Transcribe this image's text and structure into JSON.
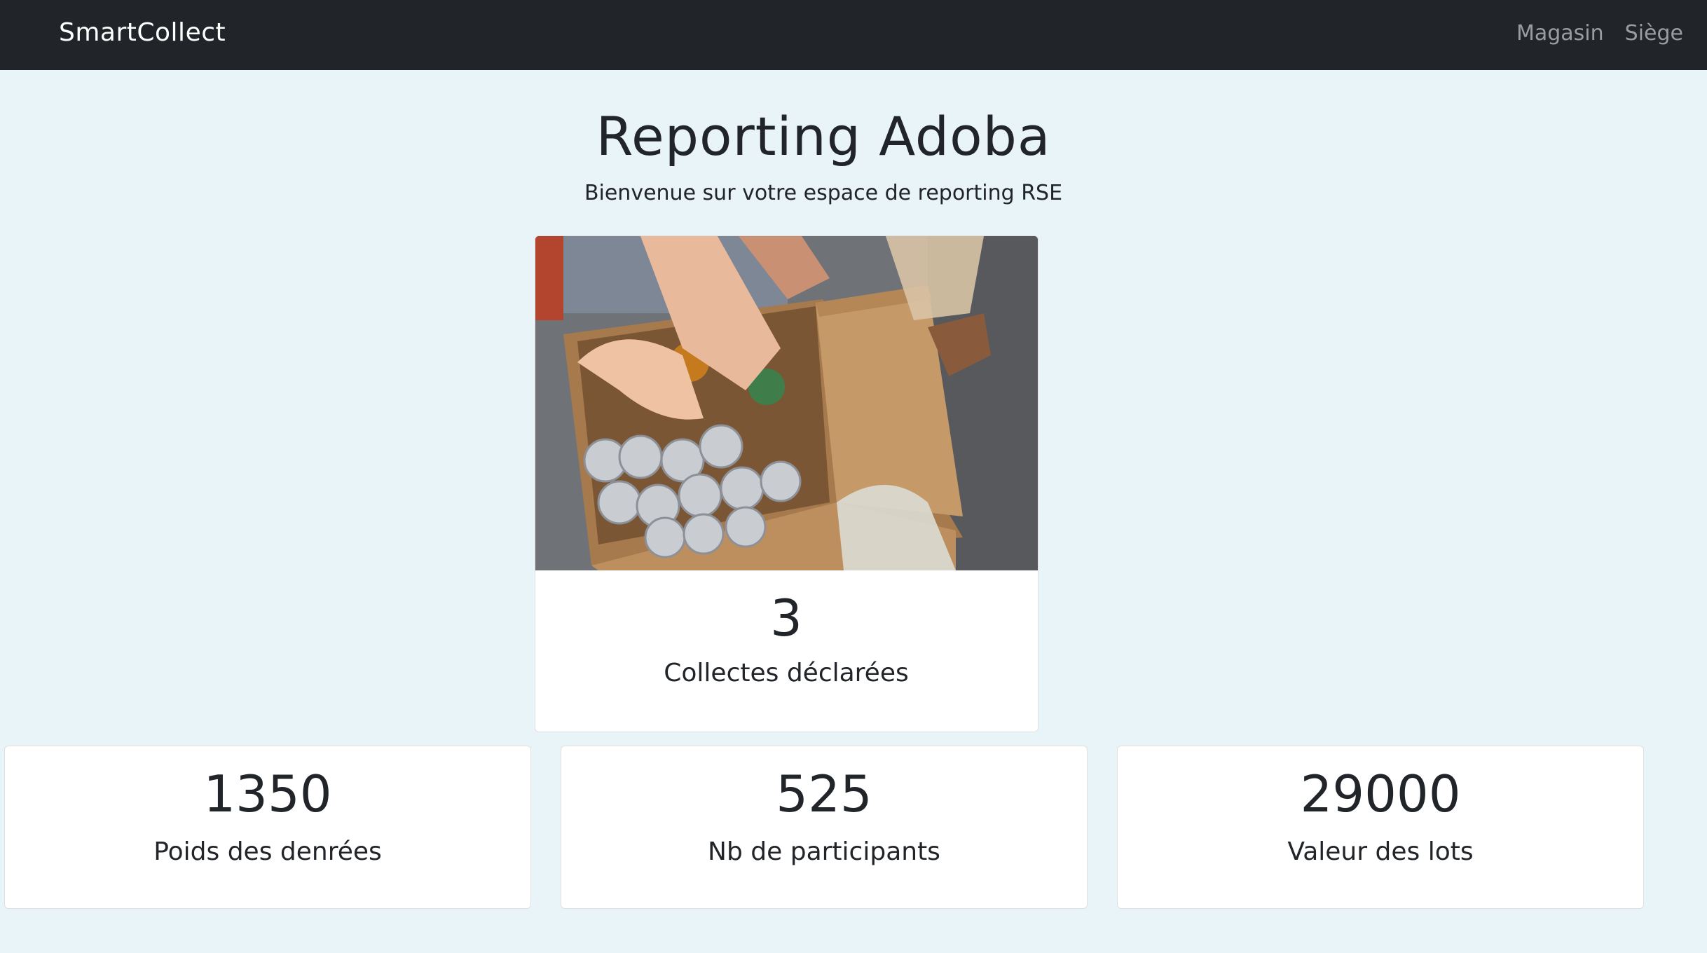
{
  "navbar": {
    "brand": "SmartCollect",
    "links": [
      {
        "label": "Magasin"
      },
      {
        "label": "Siège"
      }
    ]
  },
  "header": {
    "title": "Reporting Adoba",
    "subtitle": "Bienvenue sur votre espace de reporting RSE"
  },
  "hero": {
    "image": "photo-box-of-canned-food",
    "value": "3",
    "label": "Collectes déclarées"
  },
  "stats": [
    {
      "value": "1350",
      "label": "Poids des denrées"
    },
    {
      "value": "525",
      "label": "Nb de participants"
    },
    {
      "value": "29000",
      "label": "Valeur des lots"
    }
  ],
  "colors": {
    "navbar_bg": "#212529",
    "page_bg": "#e8f4f7",
    "card_bg": "#ffffff",
    "text": "#212529"
  }
}
